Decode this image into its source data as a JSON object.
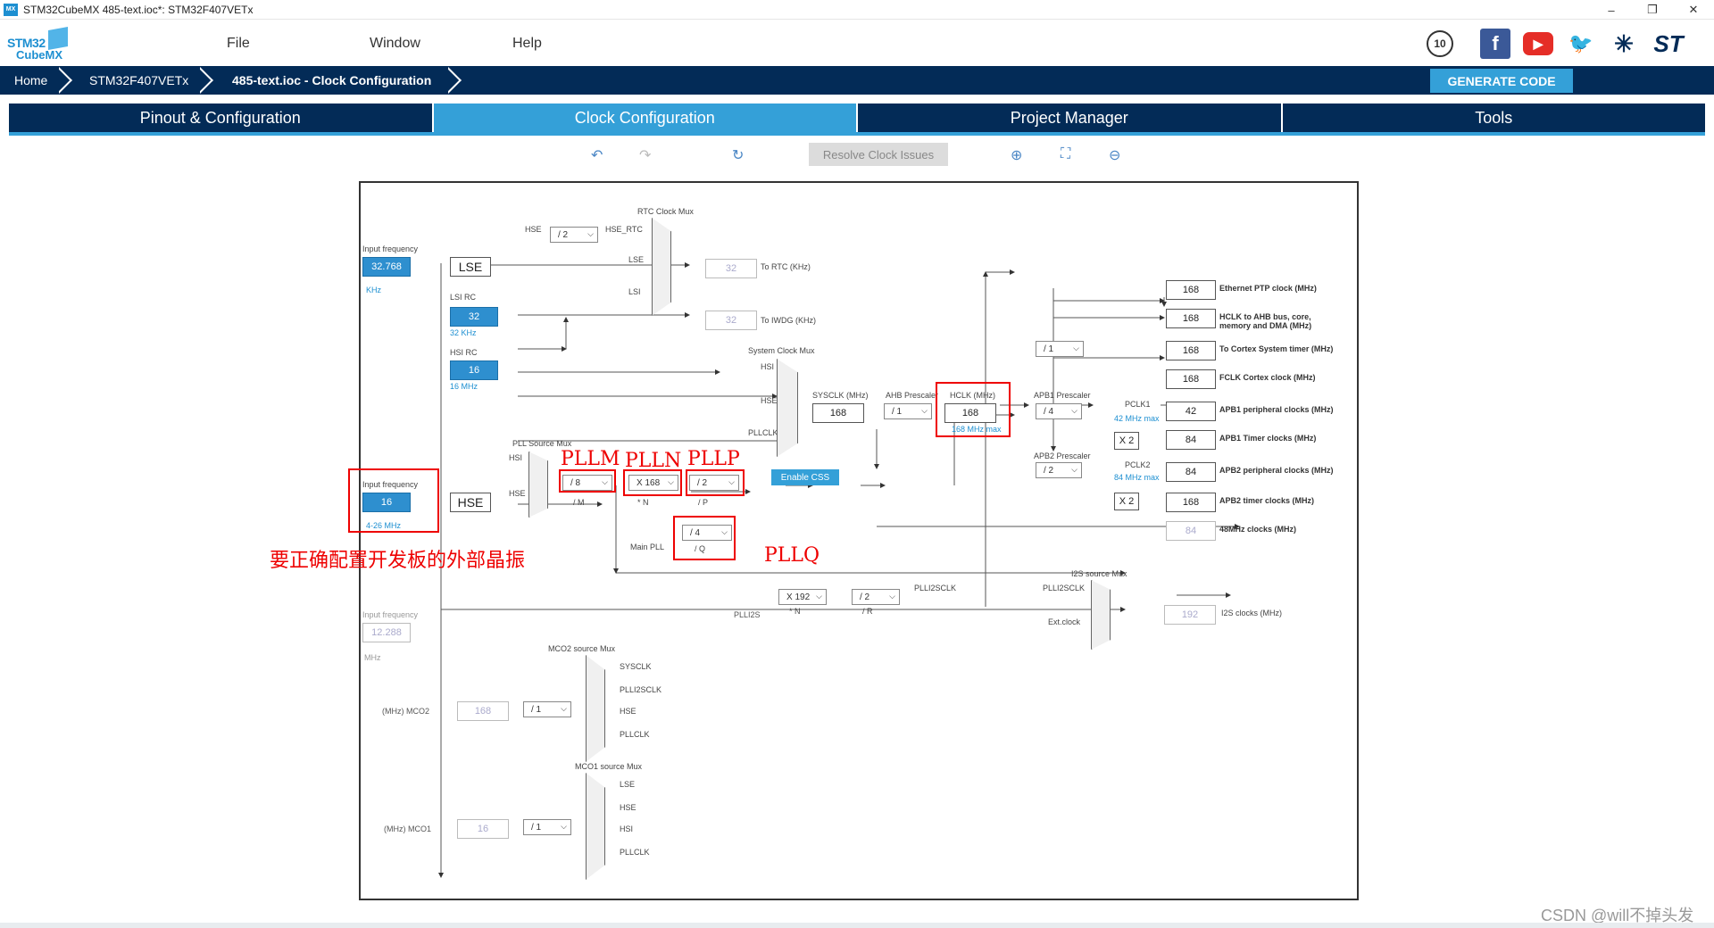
{
  "window": {
    "title": "STM32CubeMX 485-text.ioc*: STM32F407VETx",
    "app_icon": "MX",
    "minimize": "–",
    "maximize": "❐",
    "close": "✕"
  },
  "logo": {
    "line1": "STM32",
    "line2": "CubeMX"
  },
  "menu": {
    "file": "File",
    "window": "Window",
    "help": "Help"
  },
  "social": {
    "anniversary": "10",
    "facebook": "f",
    "youtube": "▶",
    "twitter": "🐦",
    "network": "✳",
    "st": "ST"
  },
  "breadcrumb": {
    "home": "Home",
    "device": "STM32F407VETx",
    "current": "485-text.ioc - Clock Configuration"
  },
  "generate_code": "GENERATE CODE",
  "tabs": [
    "Pinout & Configuration",
    "Clock Configuration",
    "Project Manager",
    "Tools"
  ],
  "toolbar": {
    "undo": "↶",
    "redo": "↷",
    "reset": "↻",
    "resolve": "Resolve Clock Issues",
    "zoom_in": "⊕",
    "fit": "⛶",
    "zoom_out": "⊖"
  },
  "clock": {
    "input_freq_label": "Input frequency",
    "lse": {
      "value": "32.768",
      "unit": "KHz",
      "label": "LSE"
    },
    "lsi": {
      "title": "LSI RC",
      "value": "32",
      "unit": "32 KHz"
    },
    "hsi": {
      "title": "HSI RC",
      "value": "16",
      "unit": "16 MHz"
    },
    "hse": {
      "value": "16",
      "range": "4-26 MHz",
      "label": "HSE"
    },
    "ext": {
      "label": "Input frequency",
      "value": "12.288",
      "unit": "MHz"
    },
    "rtc_mux": {
      "title": "RTC Clock Mux",
      "hse": "HSE",
      "div": "/ 2",
      "hse_rtc": "HSE_RTC",
      "lse": "LSE",
      "lsi": "LSI",
      "out": "32",
      "out_label": "To RTC (KHz)"
    },
    "iwdg": {
      "value": "32",
      "label": "To IWDG (KHz)"
    },
    "sys_mux": {
      "title": "System Clock Mux",
      "hsi": "HSI",
      "hse": "HSE",
      "pllclk": "PLLCLK"
    },
    "pll_src": {
      "title": "PLL Source Mux",
      "hsi": "HSI",
      "hse": "HSE"
    },
    "pll": {
      "m": "/ 8",
      "m_l": "/ M",
      "n": "X 168",
      "n_l": "* N",
      "p": "/ 2",
      "p_l": "/ P",
      "q": "/ 4",
      "q_l": "/ Q",
      "main": "Main PLL"
    },
    "enable_css": "Enable CSS",
    "sysclk": {
      "label": "SYSCLK (MHz)",
      "value": "168"
    },
    "ahb": {
      "label": "AHB Prescaler",
      "value": "/ 1"
    },
    "hclk": {
      "label": "HCLK (MHz)",
      "value": "168",
      "max": "168 MHz max"
    },
    "apb1": {
      "label": "APB1 Prescaler",
      "value": "/ 4",
      "pclk": "PCLK1",
      "max": "42 MHz max",
      "x2": "X 2"
    },
    "apb2": {
      "label": "APB2 Prescaler",
      "value": "/ 2",
      "pclk": "PCLK2",
      "max": "84 MHz max",
      "x2": "X 2"
    },
    "cortex_div": "/ 1",
    "outputs": [
      {
        "value": "168",
        "label": "Ethernet PTP clock (MHz)"
      },
      {
        "value": "168",
        "label": "HCLK to AHB bus, core, memory and DMA (MHz)"
      },
      {
        "value": "168",
        "label": "To Cortex System timer (MHz)"
      },
      {
        "value": "168",
        "label": "FCLK Cortex clock (MHz)"
      },
      {
        "value": "42",
        "label": "APB1 peripheral clocks (MHz)"
      },
      {
        "value": "84",
        "label": "APB1 Timer clocks (MHz)"
      },
      {
        "value": "84",
        "label": "APB2 peripheral clocks (MHz)"
      },
      {
        "value": "168",
        "label": "APB2 timer clocks (MHz)"
      },
      {
        "value": "84",
        "label": "48MHz clocks (MHz)"
      }
    ],
    "plli2s": {
      "n": "X 192",
      "n_l": "* N",
      "r": "/ 2",
      "r_l": "/ R",
      "title": "PLLI2S",
      "clk": "PLLI2SCLK"
    },
    "i2s_mux": {
      "title": "I2S source Mux",
      "clk": "PLLI2SCLK",
      "ext": "Ext.clock",
      "out": "192",
      "out_label": "I2S clocks (MHz)"
    },
    "mco2": {
      "title": "MCO2 source Mux",
      "sysclk": "SYSCLK",
      "plli2s": "PLLI2SCLK",
      "hse": "HSE",
      "pllclk": "PLLCLK",
      "label": "(MHz) MCO2",
      "value": "168",
      "div": "/ 1"
    },
    "mco1": {
      "title": "MCO1 source Mux",
      "lse": "LSE",
      "hse": "HSE",
      "hsi": "HSI",
      "pllclk": "PLLCLK",
      "label": "(MHz) MCO1",
      "value": "16",
      "div": "/ 1"
    }
  },
  "annotations": {
    "pllm": "PLLM",
    "plln": "PLLN",
    "pllp": "PLLP",
    "pllq": "PLLQ",
    "note": "要正确配置开发板的外部晶振"
  },
  "watermark": "CSDN @will不掉头发"
}
